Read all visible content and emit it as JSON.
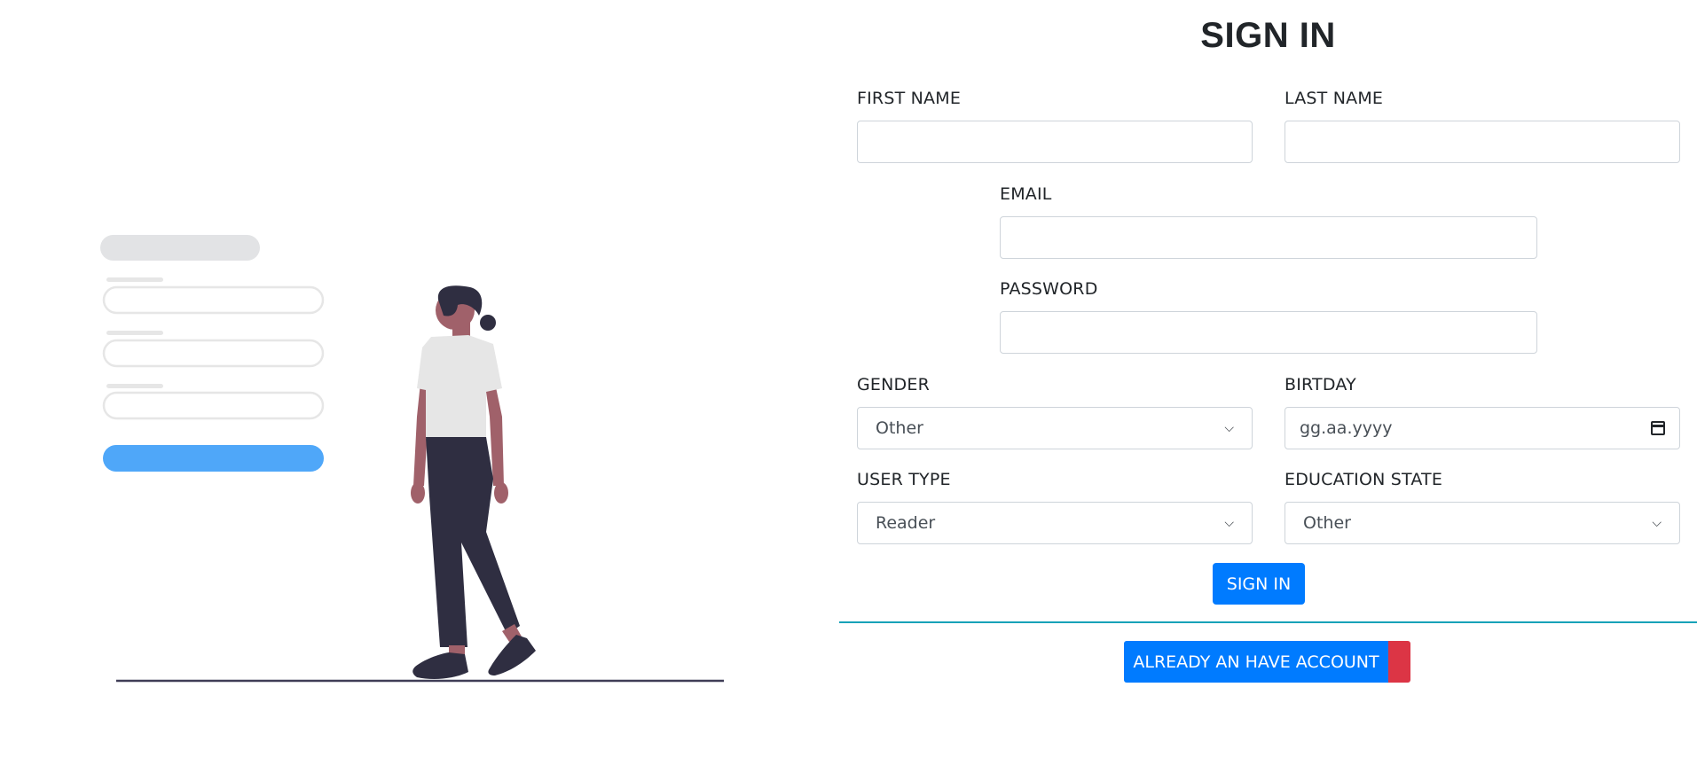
{
  "form": {
    "title": "SIGN IN",
    "first_name": {
      "label": "FIRST NAME",
      "value": ""
    },
    "last_name": {
      "label": "LAST NAME",
      "value": ""
    },
    "email": {
      "label": "EMAIL",
      "value": ""
    },
    "password": {
      "label": "PASSWORD",
      "value": ""
    },
    "gender": {
      "label": "GENDER",
      "selected": "Other"
    },
    "birthday": {
      "label": "BIRTDAY",
      "placeholder": "gg.aa.yyyy"
    },
    "user_type": {
      "label": "USER TYPE",
      "selected": "Reader"
    },
    "education_state": {
      "label": "EDUCATION STATE",
      "selected": "Other"
    },
    "submit_label": "SIGN IN",
    "account_label": "ALREADY AN HAVE ACCOUNT"
  },
  "colors": {
    "primary": "#007bff",
    "danger": "#dc3545",
    "divider": "#17a2b8",
    "illustration_button": "#4fa7f9",
    "figure_dark": "#2f2e41",
    "figure_skin": "#a0616a",
    "shirt": "#e6e6e6"
  },
  "icons": {
    "select_arrow": "chevron-down-icon",
    "date_picker": "calendar-icon"
  }
}
